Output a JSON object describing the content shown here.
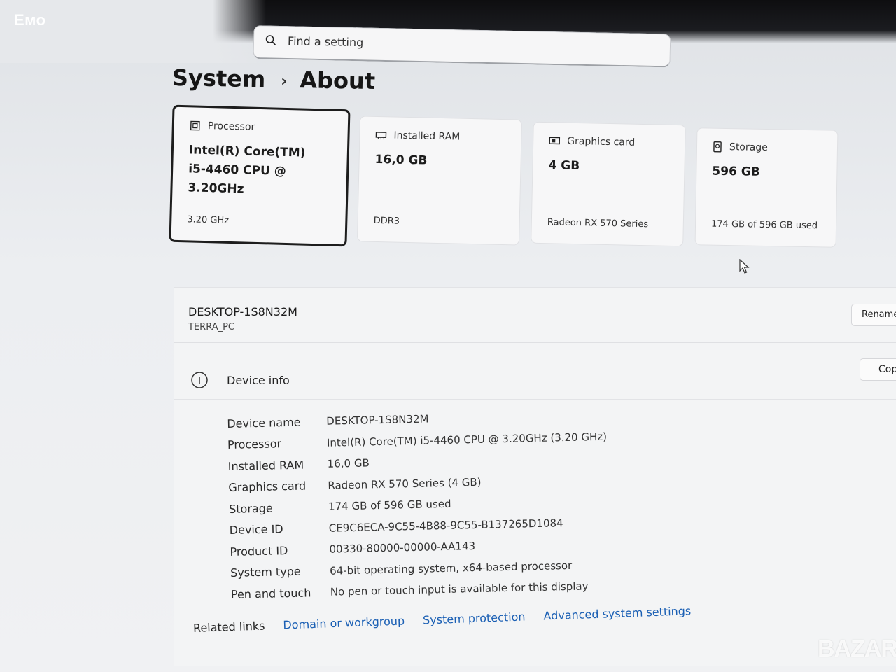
{
  "watermark_top": "Емо",
  "watermark_bottom": "BAZAR",
  "search": {
    "placeholder": "Find a setting"
  },
  "breadcrumb": {
    "parent": "System",
    "separator": "›",
    "current": "About"
  },
  "cards": [
    {
      "title": "Processor",
      "value": "Intel(R) Core(TM)\ni5-4460  CPU @\n3.20GHz",
      "sub": "3.20 GHz",
      "icon": "processor-icon"
    },
    {
      "title": "Installed RAM",
      "value": "16,0 GB",
      "sub": "DDR3",
      "icon": "ram-icon"
    },
    {
      "title": "Graphics card",
      "value": "4 GB",
      "sub": "Radeon RX 570 Series",
      "icon": "graphics-card-icon"
    },
    {
      "title": "Storage",
      "value": "596 GB",
      "sub": "174 GB of 596 GB used",
      "icon": "storage-icon"
    }
  ],
  "pc": {
    "name": "DESKTOP-1S8N32M",
    "model": "TERRA_PC",
    "rename_label": "Rename"
  },
  "device_info": {
    "title": "Device info",
    "copy_label": "Cop",
    "rows": [
      {
        "label": "Device name",
        "value": "DESKTOP-1S8N32M"
      },
      {
        "label": "Processor",
        "value": "Intel(R) Core(TM) i5-4460 CPU @ 3.20GHz (3.20 GHz)"
      },
      {
        "label": "Installed RAM",
        "value": "16,0 GB"
      },
      {
        "label": "Graphics card",
        "value": "Radeon RX 570 Series (4 GB)"
      },
      {
        "label": "Storage",
        "value": "174 GB of 596 GB used"
      },
      {
        "label": "Device ID",
        "value": "CE9C6ECA-9C55-4B88-9C55-B137265D1084"
      },
      {
        "label": "Product ID",
        "value": "00330-80000-00000-AA143"
      },
      {
        "label": "System type",
        "value": "64-bit operating system, x64-based processor"
      },
      {
        "label": "Pen and touch",
        "value": "No pen or touch input is available for this display"
      }
    ]
  },
  "related": {
    "label": "Related links",
    "links": [
      "Domain or workgroup",
      "System protection",
      "Advanced system settings"
    ]
  }
}
